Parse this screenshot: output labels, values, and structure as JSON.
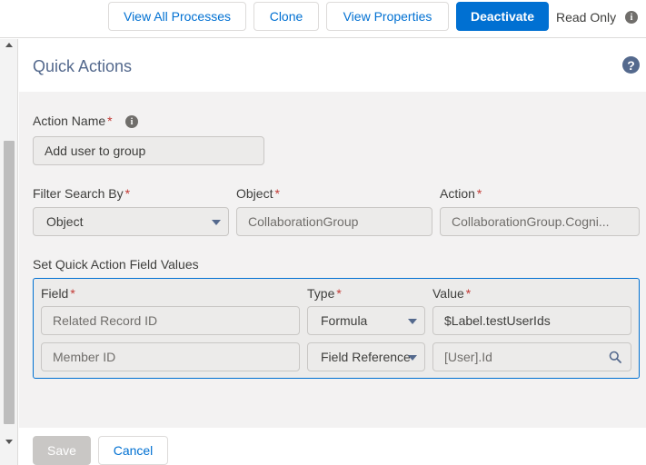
{
  "toolbar": {
    "view_all_processes": "View All Processes",
    "clone": "Clone",
    "view_properties": "View Properties",
    "deactivate": "Deactivate",
    "read_only": "Read Only",
    "info_glyph": "i"
  },
  "panel": {
    "title": "Quick Actions",
    "help_glyph": "?"
  },
  "form": {
    "action_name_label": "Action Name",
    "required_marker": "*",
    "action_name_value": "Add user to group",
    "filter_label": "Filter Search By",
    "filter_value": "Object",
    "object_label": "Object",
    "object_value": "CollaborationGroup",
    "action_label": "Action",
    "action_value": "CollaborationGroup.Cogni...",
    "field_values_label": "Set Quick Action Field Values"
  },
  "table": {
    "col_field": "Field",
    "col_type": "Type",
    "col_value": "Value",
    "rows": [
      {
        "field": "Related Record ID",
        "type": "Formula",
        "value": "$Label.testUserIds"
      },
      {
        "field": "Member ID",
        "type": "Field Reference",
        "value": "[User].Id"
      }
    ]
  },
  "footer": {
    "save": "Save",
    "cancel": "Cancel"
  },
  "colors": {
    "brand": "#0070d2",
    "required": "#c23934",
    "title": "#54698d"
  },
  "icons": [
    "info-icon",
    "help-icon",
    "chevron-down-icon",
    "search-icon",
    "scroll-up-icon",
    "scroll-down-icon"
  ]
}
